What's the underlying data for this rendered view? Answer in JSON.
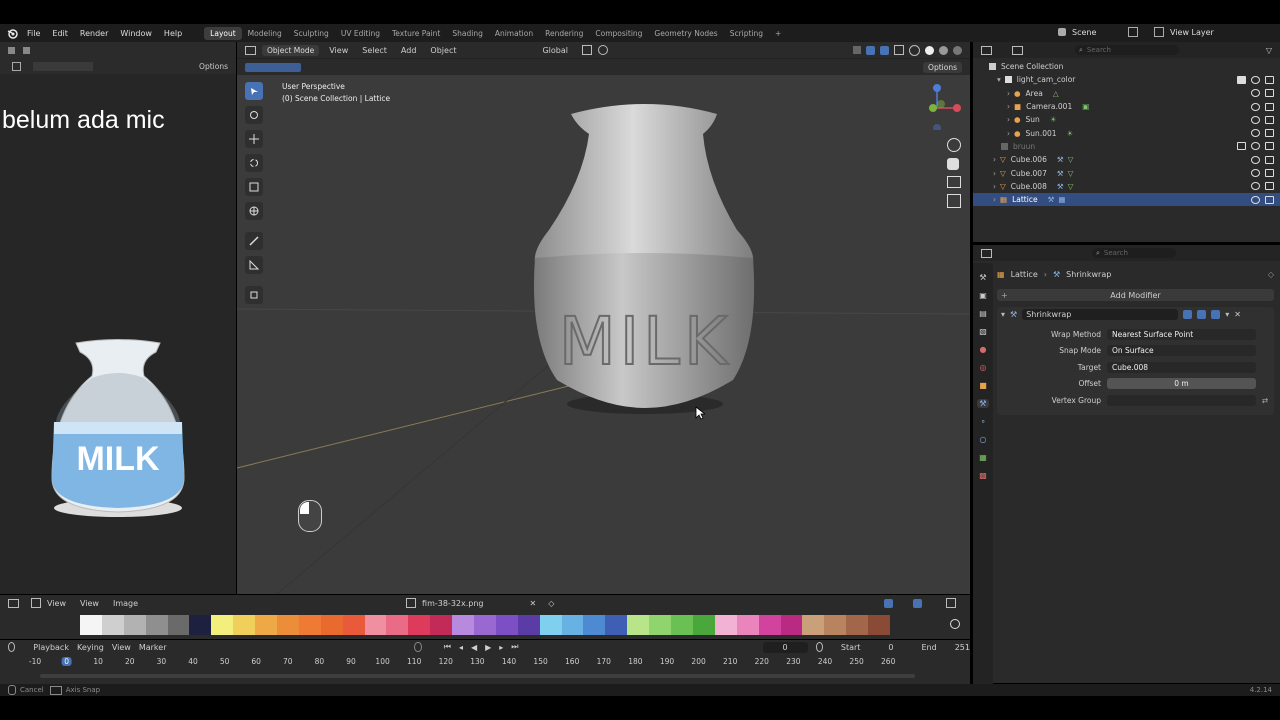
{
  "topbar": {
    "menus": [
      "File",
      "Edit",
      "Render",
      "Window",
      "Help"
    ],
    "workspaces": [
      "Layout",
      "Modeling",
      "Sculpting",
      "UV Editing",
      "Texture Paint",
      "Shading",
      "Animation",
      "Rendering",
      "Compositing",
      "Geometry Nodes",
      "Scripting"
    ],
    "active_workspace": "Layout",
    "add_tab": "+",
    "scene": "Scene",
    "view_layer": "View Layer"
  },
  "left_panel": {
    "options_label": "Options",
    "overlay_text": "belum ada mic",
    "image_label": "MILK"
  },
  "viewport": {
    "mode": "Object Mode",
    "menus": [
      "View",
      "Select",
      "Add",
      "Object"
    ],
    "transform": "Global",
    "options_label": "Options",
    "info_line1": "User Perspective",
    "info_line2": "(0) Scene Collection | Lattice",
    "model_text": "MILK"
  },
  "outliner": {
    "search_placeholder": "Search",
    "root": "Scene Collection",
    "items": [
      {
        "label": "light_cam_color",
        "indent": 1
      },
      {
        "label": "Area",
        "indent": 2
      },
      {
        "label": "Camera.001",
        "indent": 2
      },
      {
        "label": "Sun",
        "indent": 2
      },
      {
        "label": "Sun.001",
        "indent": 2
      },
      {
        "label": "bruun",
        "indent": 1
      },
      {
        "label": "Cube.006",
        "indent": 1
      },
      {
        "label": "Cube.007",
        "indent": 1
      },
      {
        "label": "Cube.008",
        "indent": 1
      },
      {
        "label": "Lattice",
        "indent": 1
      }
    ]
  },
  "properties": {
    "search_placeholder": "Search",
    "breadcrumb_object": "Lattice",
    "breadcrumb_modifier": "Shrinkwrap",
    "add_modifier": "Add Modifier",
    "modifier_name": "Shrinkwrap",
    "fields": [
      {
        "label": "Wrap Method",
        "value": "Nearest Surface Point"
      },
      {
        "label": "Snap Mode",
        "value": "On Surface"
      },
      {
        "label": "Target",
        "value": "Cube.008"
      },
      {
        "label": "Offset",
        "value": "0 m"
      },
      {
        "label": "Vertex Group",
        "value": ""
      }
    ]
  },
  "image_editor": {
    "menus": [
      "View",
      "View",
      "Image"
    ],
    "filename": "fim-38-32x.png",
    "palette": [
      "#f5f5f5",
      "#cfcfcf",
      "#b2b2b2",
      "#8f8f8f",
      "#6a6a6a",
      "#1e2040",
      "#f3ef7d",
      "#f0d05a",
      "#eea846",
      "#ec8d3a",
      "#ee7a33",
      "#e96a2e",
      "#e85a3a",
      "#ef8fa0",
      "#ea6b86",
      "#dd3a5c",
      "#c22a57",
      "#b78ae0",
      "#9a68d1",
      "#7c4fc4",
      "#5b3ba6",
      "#7fd0ef",
      "#67b1e3",
      "#4d8ad1",
      "#3e5fb3",
      "#b8e58a",
      "#8fd46c",
      "#6ac052",
      "#4aa73b",
      "#f2b2d4",
      "#ea84bd",
      "#d2439e",
      "#b92a82",
      "#c9a07a",
      "#b7845f",
      "#a2664a",
      "#8a4a35"
    ]
  },
  "timeline": {
    "menus": [
      "Playback",
      "Keying",
      "View",
      "Marker"
    ],
    "frame": "0",
    "start_label": "Start",
    "start": "0",
    "end_label": "End",
    "end": "251",
    "ticks": [
      "-10",
      "0",
      "10",
      "20",
      "30",
      "40",
      "50",
      "60",
      "70",
      "80",
      "90",
      "100",
      "110",
      "120",
      "130",
      "140",
      "150",
      "160",
      "170",
      "180",
      "190",
      "200",
      "210",
      "220",
      "230",
      "240",
      "250",
      "260"
    ],
    "current_frame": "0"
  },
  "statusbar": {
    "hint1": "Cancel",
    "hint2": "Axis Snap",
    "version": "4.2.14"
  },
  "colors": {
    "accent": "#4772b3",
    "selection": "#334d80",
    "viewport_bg": "#3b3b3b",
    "panel_bg": "#2a2a2a"
  }
}
